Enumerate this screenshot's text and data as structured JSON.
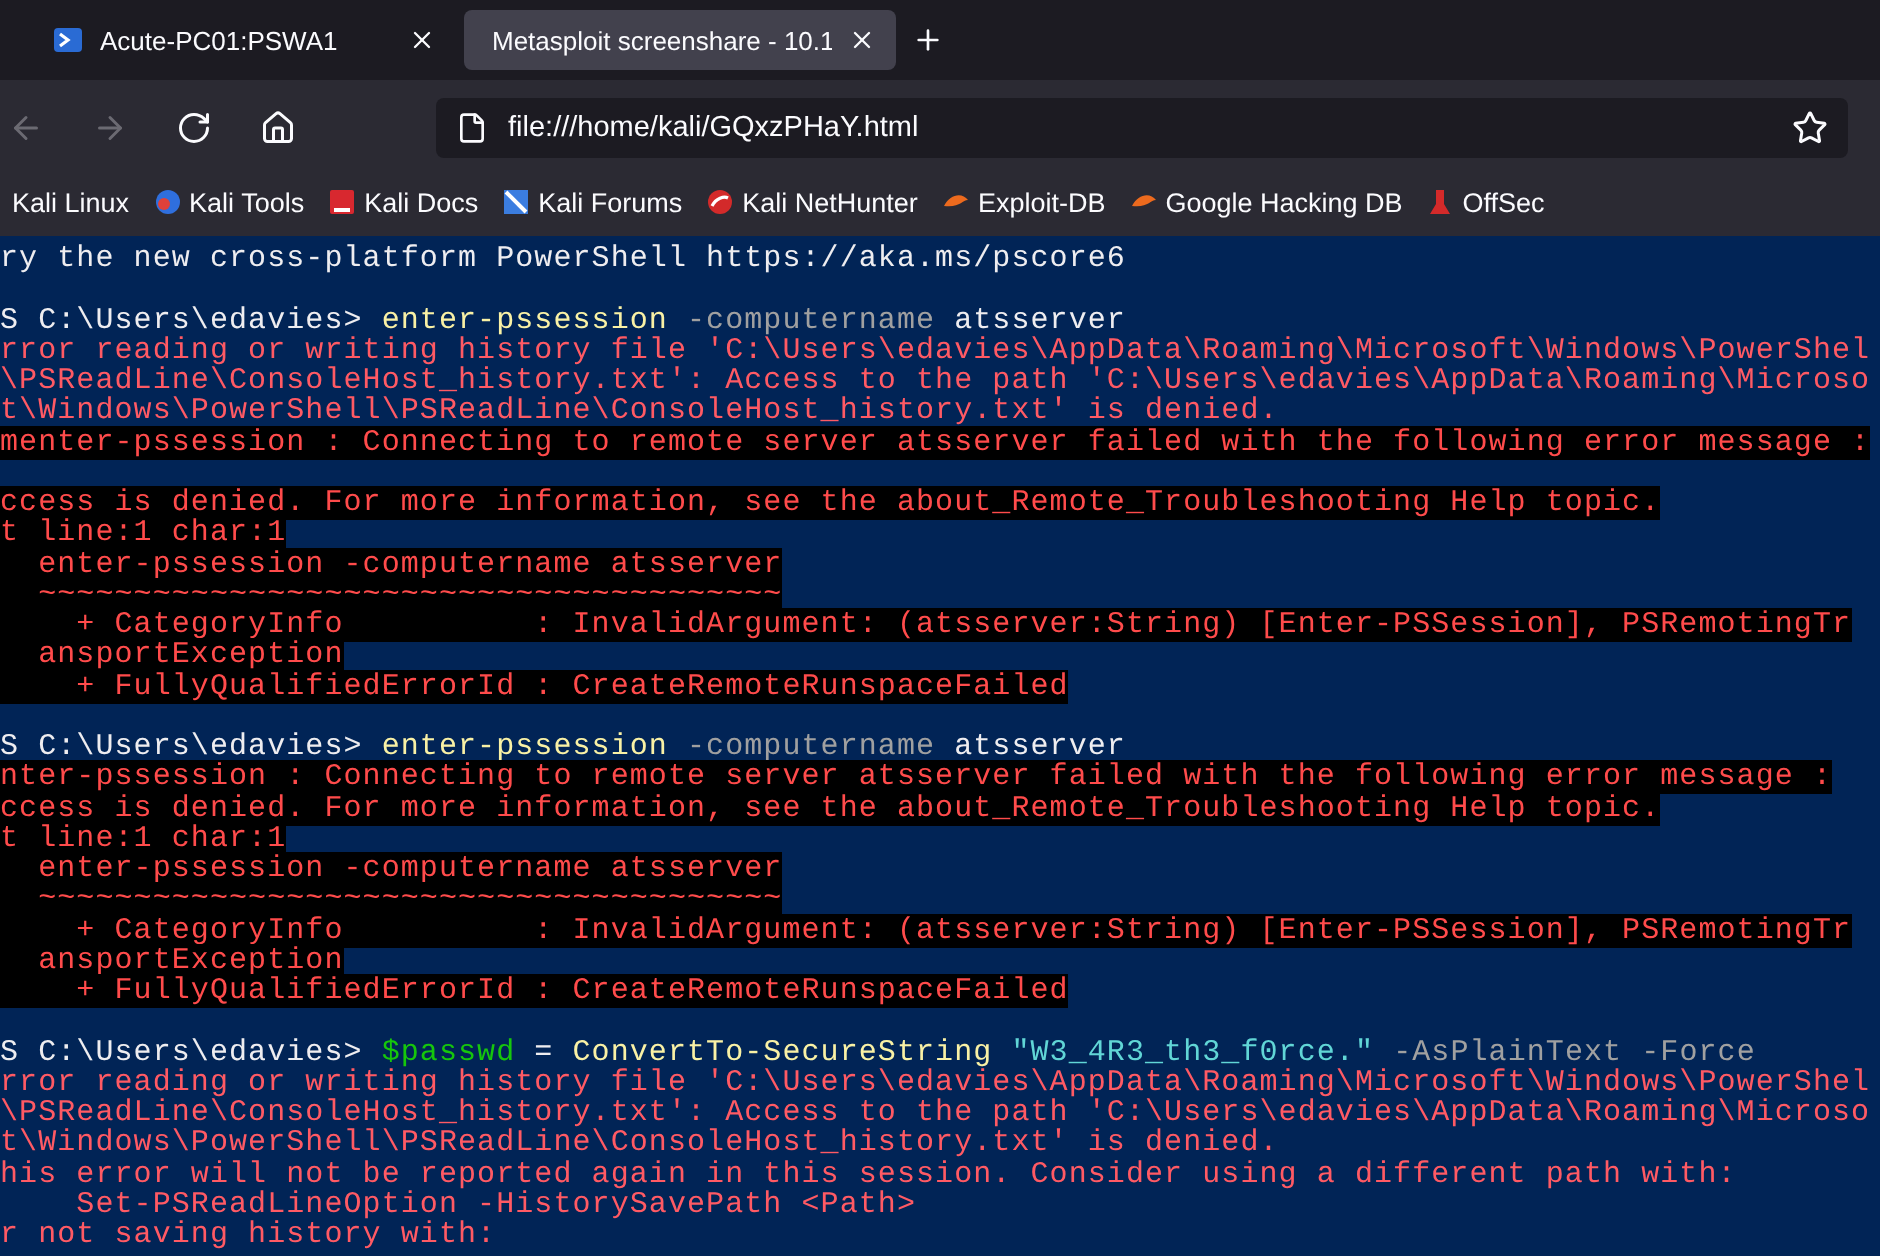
{
  "tabs": [
    {
      "title": "Acute-PC01:PSWA1",
      "selected": false
    },
    {
      "title": "Metasploit screenshare - 10.1",
      "selected": true
    }
  ],
  "nav": [
    {
      "kind": "back",
      "disabled": true
    },
    {
      "kind": "forward",
      "disabled": true
    },
    {
      "kind": "reload",
      "disabled": false
    },
    {
      "kind": "home",
      "disabled": false
    }
  ],
  "address": {
    "value": "file:///home/kali/GQxzPHaY.html",
    "bookmarked": false
  },
  "bookmarks": [
    "Kali Linux",
    "Kali Tools",
    "Kali Docs",
    "Kali Forums",
    "Kali NetHunter",
    "Exploit-DB",
    "Google Hacking DB",
    "OffSec"
  ],
  "terminal": [
    {
      "kind": "text",
      "segments": [
        {
          "kind": "plain",
          "text": "ry the new cross-platform PowerShell https://aka.ms/pscore6"
        }
      ]
    },
    {
      "kind": "blank"
    },
    {
      "kind": "text",
      "segments": [
        {
          "kind": "plain",
          "text": "S C:\\Users\\edavies> "
        },
        {
          "kind": "command",
          "text": "enter-pssession"
        },
        {
          "kind": "parameter",
          "text": " -computername"
        },
        {
          "kind": "plain",
          "text": " atsserver"
        }
      ]
    },
    {
      "kind": "text",
      "segments": [
        {
          "kind": "warning",
          "text": "rror reading or writing history file 'C:\\Users\\edavies\\AppData\\Roaming\\Microsoft\\Windows\\PowerShel"
        }
      ]
    },
    {
      "kind": "text",
      "segments": [
        {
          "kind": "warning",
          "text": "\\PSReadLine\\ConsoleHost_history.txt': Access to the path 'C:\\Users\\edavies\\AppData\\Roaming\\Microso"
        }
      ]
    },
    {
      "kind": "text",
      "segments": [
        {
          "kind": "warning",
          "text": "t\\Windows\\PowerShell\\PSReadLine\\ConsoleHost_history.txt' is denied."
        }
      ]
    },
    {
      "kind": "text",
      "segments": [
        {
          "kind": "error",
          "text": "menter-pssession : Connecting to remote server atsserver failed with the following error message :"
        }
      ]
    },
    {
      "kind": "blank"
    },
    {
      "kind": "text",
      "segments": [
        {
          "kind": "error",
          "text": "ccess is denied. For more information, see the about_Remote_Troubleshooting Help topic."
        }
      ]
    },
    {
      "kind": "text",
      "segments": [
        {
          "kind": "error",
          "text": "t line:1 char:1"
        }
      ]
    },
    {
      "kind": "text",
      "segments": [
        {
          "kind": "error",
          "text": "  enter-pssession -computername atsserver"
        }
      ]
    },
    {
      "kind": "text",
      "segments": [
        {
          "kind": "error",
          "text": "  ~~~~~~~~~~~~~~~~~~~~~~~~~~~~~~~~~~~~~~~"
        }
      ]
    },
    {
      "kind": "text",
      "segments": [
        {
          "kind": "error",
          "text": "    + CategoryInfo          : InvalidArgument: (atsserver:String) [Enter-PSSession], PSRemotingTr"
        }
      ]
    },
    {
      "kind": "text",
      "segments": [
        {
          "kind": "error",
          "text": "  ansportException"
        }
      ]
    },
    {
      "kind": "text",
      "segments": [
        {
          "kind": "error",
          "text": "    + FullyQualifiedErrorId : CreateRemoteRunspaceFailed"
        }
      ]
    },
    {
      "kind": "blank"
    },
    {
      "kind": "text",
      "segments": [
        {
          "kind": "plain",
          "text": "S C:\\Users\\edavies> "
        },
        {
          "kind": "command",
          "text": "enter-pssession"
        },
        {
          "kind": "parameter",
          "text": " -computername"
        },
        {
          "kind": "plain",
          "text": " atsserver"
        }
      ]
    },
    {
      "kind": "text",
      "segments": [
        {
          "kind": "error",
          "text": "nter-pssession : Connecting to remote server atsserver failed with the following error message :"
        }
      ]
    },
    {
      "kind": "text",
      "segments": [
        {
          "kind": "error",
          "text": "ccess is denied. For more information, see the about_Remote_Troubleshooting Help topic."
        }
      ]
    },
    {
      "kind": "text",
      "segments": [
        {
          "kind": "error",
          "text": "t line:1 char:1"
        }
      ]
    },
    {
      "kind": "text",
      "segments": [
        {
          "kind": "error",
          "text": "  enter-pssession -computername atsserver"
        }
      ]
    },
    {
      "kind": "text",
      "segments": [
        {
          "kind": "error",
          "text": "  ~~~~~~~~~~~~~~~~~~~~~~~~~~~~~~~~~~~~~~~"
        }
      ]
    },
    {
      "kind": "text",
      "segments": [
        {
          "kind": "error",
          "text": "    + CategoryInfo          : InvalidArgument: (atsserver:String) [Enter-PSSession], PSRemotingTr"
        }
      ]
    },
    {
      "kind": "text",
      "segments": [
        {
          "kind": "error",
          "text": "  ansportException"
        }
      ]
    },
    {
      "kind": "text",
      "segments": [
        {
          "kind": "error",
          "text": "    + FullyQualifiedErrorId : CreateRemoteRunspaceFailed"
        }
      ]
    },
    {
      "kind": "blank"
    },
    {
      "kind": "text",
      "segments": [
        {
          "kind": "plain",
          "text": "S C:\\Users\\edavies> "
        },
        {
          "kind": "variable",
          "text": "$passwd"
        },
        {
          "kind": "plain",
          "text": " = "
        },
        {
          "kind": "command",
          "text": "ConvertTo-SecureString"
        },
        {
          "kind": "string",
          "text": " \"W3_4R3_th3_f0rce.\""
        },
        {
          "kind": "parameter",
          "text": " -AsPlainText -Force"
        }
      ]
    },
    {
      "kind": "text",
      "segments": [
        {
          "kind": "warning",
          "text": "rror reading or writing history file 'C:\\Users\\edavies\\AppData\\Roaming\\Microsoft\\Windows\\PowerShel"
        }
      ]
    },
    {
      "kind": "text",
      "segments": [
        {
          "kind": "warning",
          "text": "\\PSReadLine\\ConsoleHost_history.txt': Access to the path 'C:\\Users\\edavies\\AppData\\Roaming\\Microso"
        }
      ]
    },
    {
      "kind": "text",
      "segments": [
        {
          "kind": "warning",
          "text": "t\\Windows\\PowerShell\\PSReadLine\\ConsoleHost_history.txt' is denied."
        }
      ]
    },
    {
      "kind": "text",
      "segments": [
        {
          "kind": "warning",
          "text": "his error will not be reported again in this session. Consider using a different path with:"
        }
      ]
    },
    {
      "kind": "text",
      "segments": [
        {
          "kind": "warning",
          "text": "    Set-PSReadLineOption -HistorySavePath <Path>"
        }
      ]
    },
    {
      "kind": "text",
      "segments": [
        {
          "kind": "warning",
          "text": "r not saving history with:"
        }
      ]
    }
  ]
}
